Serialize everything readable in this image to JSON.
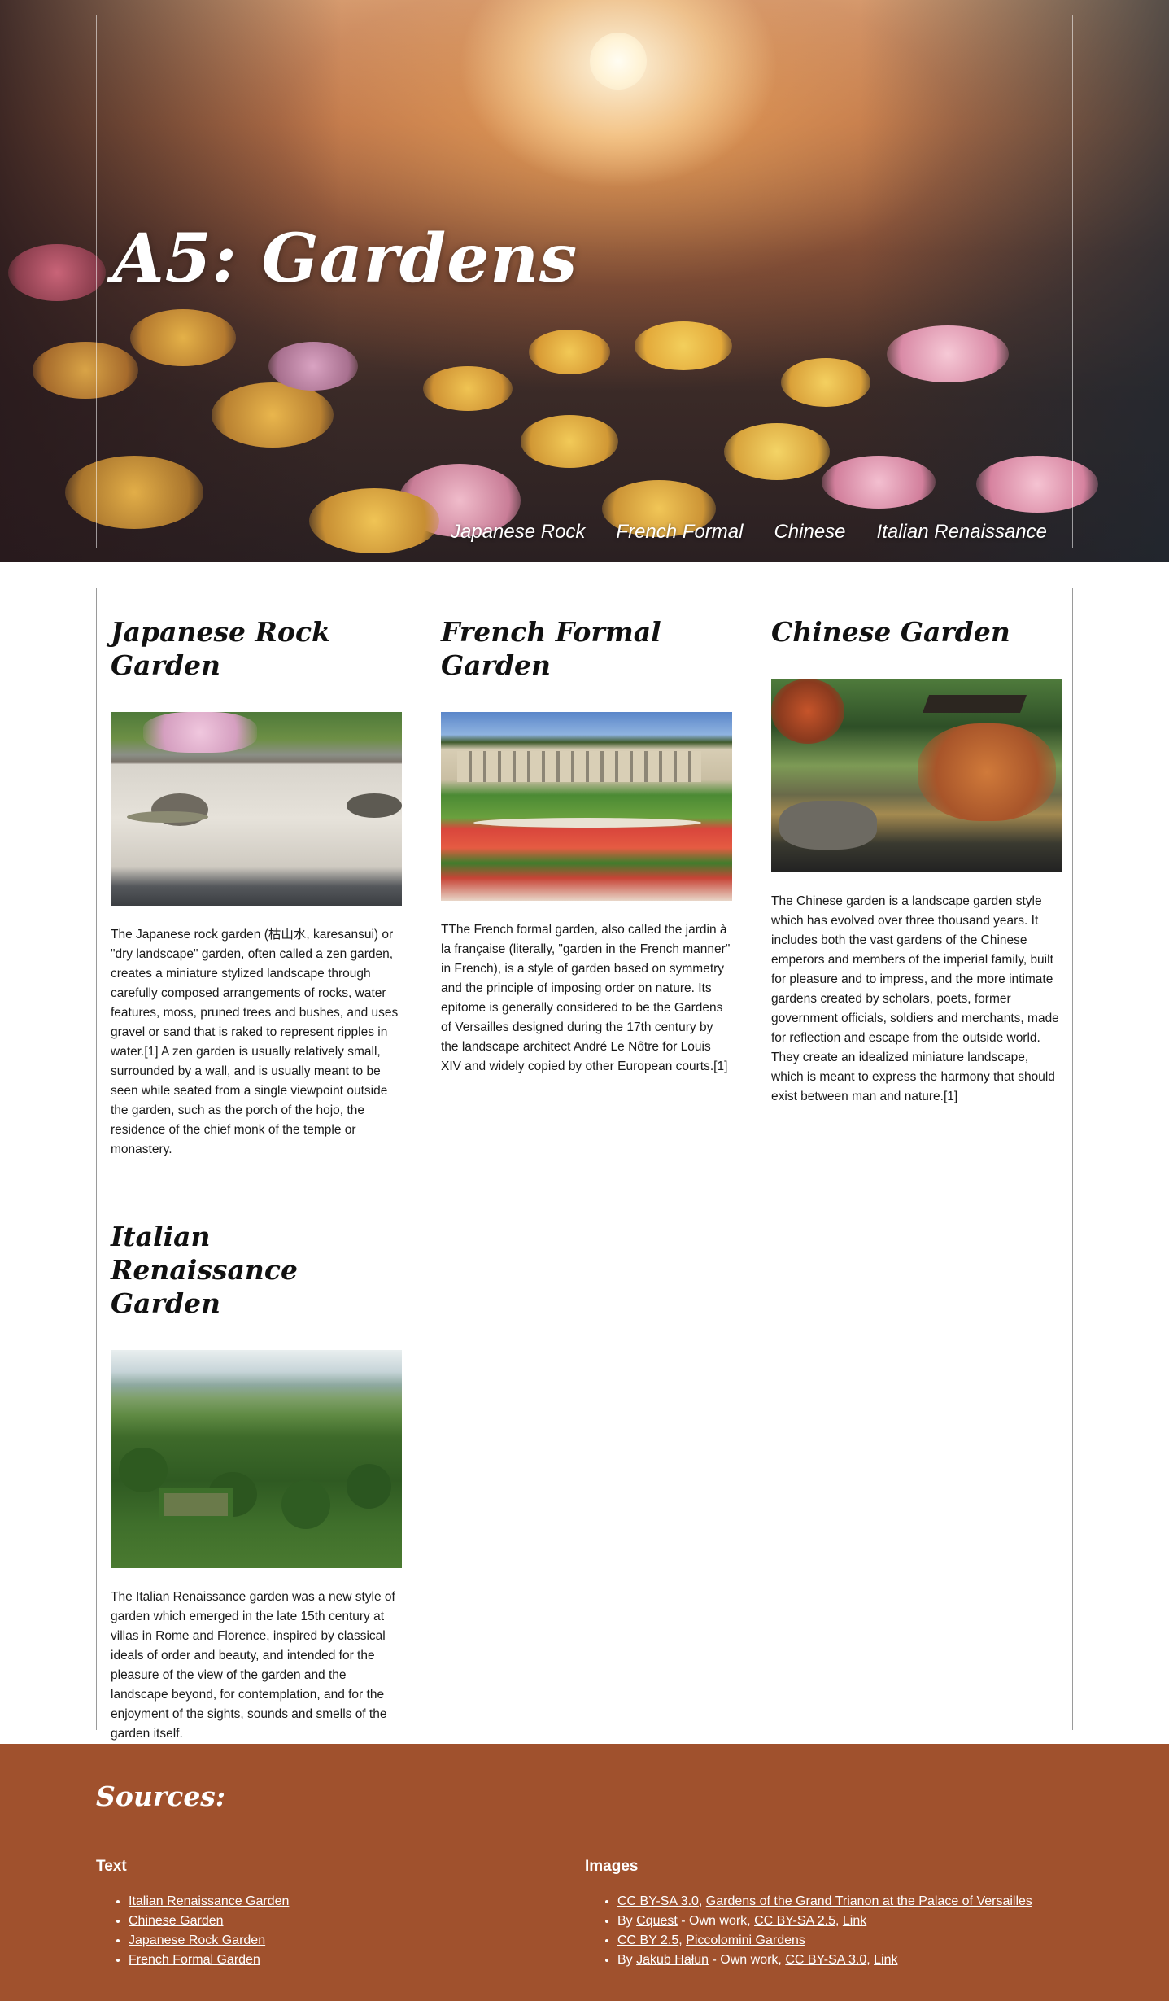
{
  "header": {
    "title": "A5: Gardens",
    "nav": [
      "Japanese Rock",
      "French Formal",
      "Chinese",
      "Italian Renaissance"
    ]
  },
  "gardens": [
    {
      "title": "Japanese Rock Garden",
      "text": "The Japanese rock garden (枯山水, karesansui) or \"dry landscape\" garden, often called a zen garden, creates a miniature stylized landscape through carefully composed arrangements of rocks, water features, moss, pruned trees and bushes, and uses gravel or sand that is raked to represent ripples in water.[1] A zen garden is usually relatively small, surrounded by a wall, and is usually meant to be seen while seated from a single viewpoint outside the garden, such as the porch of the hojo, the residence of the chief monk of the temple or monastery."
    },
    {
      "title": "French Formal Garden",
      "text": "TThe French formal garden, also called the jardin à la française (literally, \"garden in the French manner\" in French), is a style of garden based on symmetry and the principle of imposing order on nature. Its epitome is generally considered to be the Gardens of Versailles designed during the 17th century by the landscape architect André Le Nôtre for Louis XIV and widely copied by other European courts.[1]"
    },
    {
      "title": "Chinese Garden",
      "text": "The Chinese garden is a landscape garden style which has evolved over three thousand years. It includes both the vast gardens of the Chinese emperors and members of the imperial family, built for pleasure and to impress, and the more intimate gardens created by scholars, poets, former government officials, soldiers and merchants, made for reflection and escape from the outside world. They create an idealized miniature landscape, which is meant to express the harmony that should exist between man and nature.[1]"
    },
    {
      "title": "Italian Renaissance Garden",
      "text": "The Italian Renaissance garden was a new style of garden which emerged in the late 15th century at villas in Rome and Florence, inspired by classical ideals of order and beauty, and intended for the pleasure of the view of the garden and the landscape beyond, for contemplation, and for the enjoyment of the sights, sounds and smells of the garden itself."
    }
  ],
  "sources": {
    "heading": "Sources:",
    "text_heading": "Text",
    "text_links": [
      "Italian Renaissance Garden",
      "Chinese Garden",
      "Japanese Rock Garden",
      "French Formal Garden"
    ],
    "images_heading": "Images",
    "images": [
      {
        "link1": "CC BY-SA 3.0",
        "sep1": ", ",
        "link2": "Gardens of the Grand Trianon at the Palace of Versailles"
      },
      {
        "pre": "By ",
        "link1": "Cquest",
        "mid": " - Own work, ",
        "link2": "CC BY-SA 2.5",
        "sep": ", ",
        "link3": "Link"
      },
      {
        "link1": "CC BY 2.5",
        "sep1": ", ",
        "link2": "Piccolomini Gardens"
      },
      {
        "pre": "By ",
        "link1": "Jakub Hałun",
        "mid": " - Own work, ",
        "link2": "CC BY-SA 3.0",
        "sep": ", ",
        "link3": "Link"
      }
    ]
  },
  "colors": {
    "footer_bg": "#a0512d",
    "frame_lines": "#9a9a9a"
  }
}
